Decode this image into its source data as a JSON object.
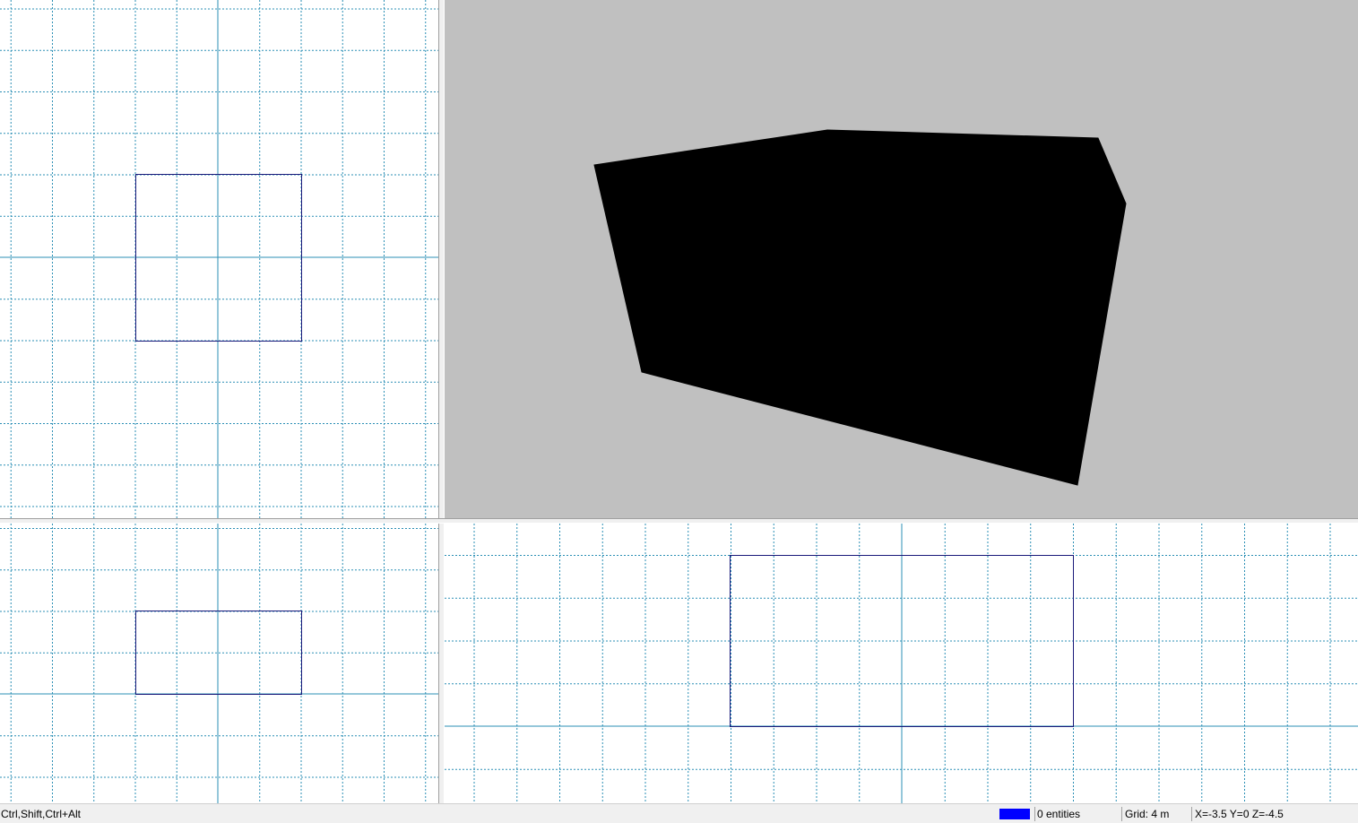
{
  "viewports": {
    "top_left": {
      "grid_color": "#2b8fb5",
      "axis_color": "#2b8fb5",
      "shape_color": "#1a1a7a"
    },
    "perspective": {
      "background": "#c0c0c0",
      "object_color": "#000000"
    },
    "bottom_left": {
      "grid_color": "#2b8fb5",
      "axis_color": "#2b8fb5",
      "shape_color": "#1a1a7a"
    },
    "bottom_right": {
      "grid_color": "#2b8fb5",
      "axis_color": "#2b8fb5",
      "shape_color": "#1a1a7a"
    }
  },
  "statusbar": {
    "hint": "Ctrl,Shift,Ctrl+Alt",
    "color_swatch": "#0000ff",
    "entities": "0 entities",
    "grid": "Grid: 4 m",
    "coords": "X=-3.5 Y=0 Z=-4.5"
  }
}
